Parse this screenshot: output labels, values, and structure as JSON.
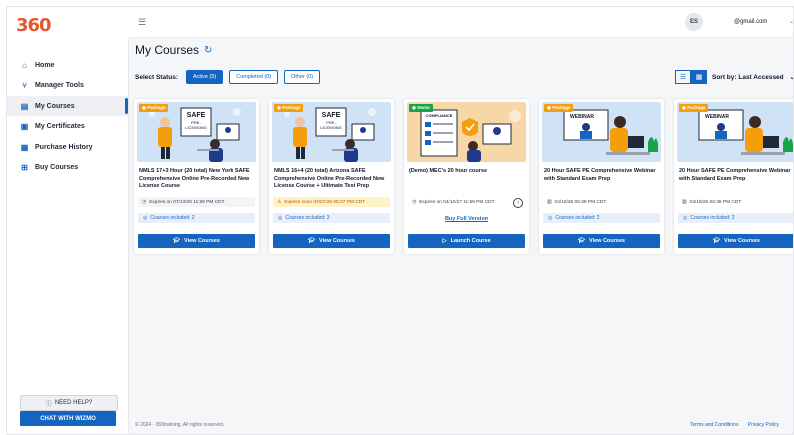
{
  "brand": {
    "logo_text": "360",
    "accent": "#1565c0"
  },
  "sidebar": {
    "items": [
      {
        "label": "Home",
        "icon": "home-icon"
      },
      {
        "label": "Manager Tools",
        "icon": "hierarchy-icon"
      },
      {
        "label": "My Courses",
        "icon": "courses-icon",
        "active": true
      },
      {
        "label": "My Certificates",
        "icon": "certificate-icon"
      },
      {
        "label": "Purchase History",
        "icon": "receipt-icon"
      },
      {
        "label": "Buy Courses",
        "icon": "cart-icon"
      }
    ],
    "help_label": "NEED HELP?",
    "chat_label": "CHAT WITH WIZMO"
  },
  "header": {
    "avatar_initials": "ES",
    "email": "@gmail.com"
  },
  "page": {
    "title": "My Courses",
    "status_label": "Select Status:",
    "filters": [
      "Active (5)",
      "Completed (0)",
      "Other (0)"
    ],
    "sort_label": "Sort by: Last Accessed"
  },
  "cards": [
    {
      "badge": "Package",
      "image": "safe-pre-licensing",
      "title": "NMLS 17+3 Hour (20 total) New York SAFE Comprehensive Online Pre-Recorded New License Course",
      "expires": "Expires on 07/13/26 11:59 PM CDT",
      "included": "Courses included: 2",
      "button": "View Courses"
    },
    {
      "badge": "Package",
      "image": "safe-pre-licensing",
      "title": "NMLS 16+4 (20 total) Arizona SAFE Comprehensive Online Pre-Recorded New License Course + Ultimate Test Prep",
      "expires": "Expires soon 04/07/26 05:37 PM CDT",
      "included": "Courses included: 3",
      "button": "View Courses"
    },
    {
      "badge": "Demo",
      "image": "compliance",
      "title": "(Demo) MEC's 20 hour course",
      "expires": "Expires on 04/10/27 11:59 PM CDT",
      "link": "Buy Full Version",
      "button": "Launch Course"
    },
    {
      "badge": "Package",
      "image": "webinar",
      "title": "20 Hour SAFE PE Comprehensive Webinar with Standard Exam Prep",
      "expires": "04/15/26 06:38 PM CDT",
      "included": "Courses included: 2",
      "button": "View Courses"
    },
    {
      "badge": "Package",
      "image": "webinar",
      "title": "20 Hour SAFE PE Comprehensive Webinar with Standard Exam Prep",
      "expires": "04/15/26 06:38 PM CDT",
      "included": "Courses included: 2",
      "button": "View Courses"
    }
  ],
  "footer": {
    "copyright": "© 2024 - 360training. All rights reserved.",
    "links": [
      "Terms and Conditions",
      "Privacy Policy"
    ]
  }
}
